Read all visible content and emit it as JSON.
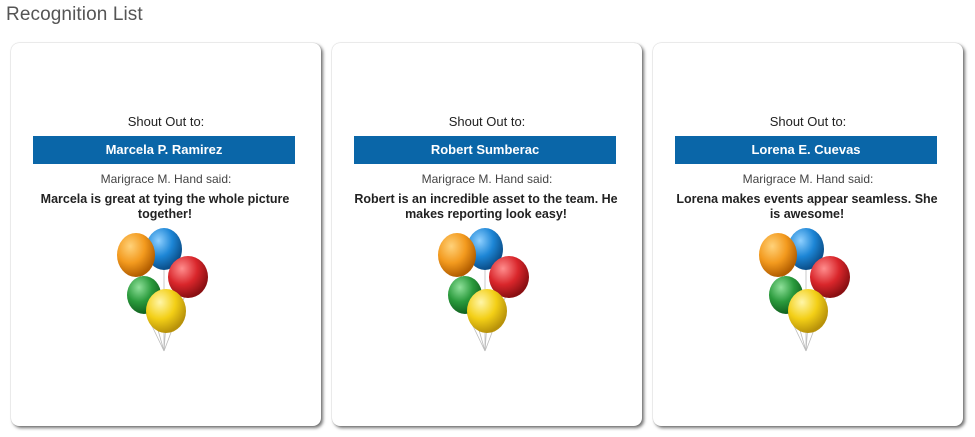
{
  "page": {
    "title": "Recognition List"
  },
  "cards": [
    {
      "shout_label": "Shout Out to:",
      "recipient": "Marcela P. Ramirez",
      "said_label": "Marigrace M. Hand said:",
      "message": "Marcela is great at tying the whole picture together!",
      "image_icon": "balloons-icon"
    },
    {
      "shout_label": "Shout Out to:",
      "recipient": "Robert Sumberac",
      "said_label": "Marigrace M. Hand said:",
      "message": "Robert is an incredible asset to the team. He makes reporting look easy!",
      "image_icon": "balloons-icon"
    },
    {
      "shout_label": "Shout Out to:",
      "recipient": "Lorena E. Cuevas",
      "said_label": "Marigrace M. Hand said:",
      "message": "Lorena makes events appear seamless. She is awesome!",
      "image_icon": "balloons-icon"
    }
  ],
  "colors": {
    "name_bar": "#0a66a8",
    "balloon_orange": "#f39a1e",
    "balloon_blue": "#1d86d6",
    "balloon_red": "#d9262b",
    "balloon_green": "#2a9a3c",
    "balloon_yellow": "#f3cf16"
  }
}
